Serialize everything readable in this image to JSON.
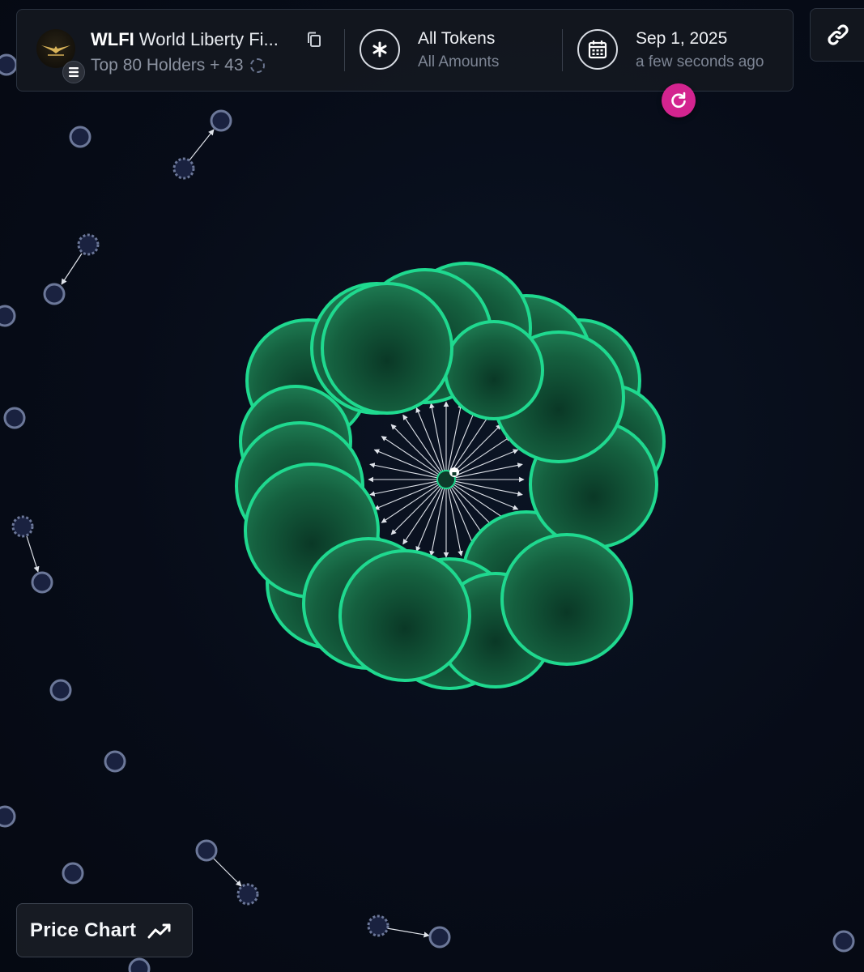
{
  "token": {
    "symbol": "WLFI",
    "name": "World Liberty Fi...",
    "holders_label": "Top 80 Holders + 43",
    "logo_icon": "eagle-logo-icon",
    "chain_icon": "solana-icon"
  },
  "filter": {
    "title": "All Tokens",
    "subtitle": "All Amounts",
    "icon": "asterisk-icon"
  },
  "date": {
    "title": "Sep 1, 2025",
    "subtitle": "a few seconds ago",
    "icon": "calendar-icon"
  },
  "refresh": {
    "icon": "refresh-icon",
    "color": "#d3248f"
  },
  "link_button": {
    "icon": "link-icon"
  },
  "price_chart_button": {
    "label": "Price Chart",
    "icon": "trend-line-icon"
  },
  "graph": {
    "bubble_color": "#1fd98f",
    "bubble_fill": "#0c4a33",
    "node_color": "#6c7899",
    "center_icon": "lock-icon"
  }
}
